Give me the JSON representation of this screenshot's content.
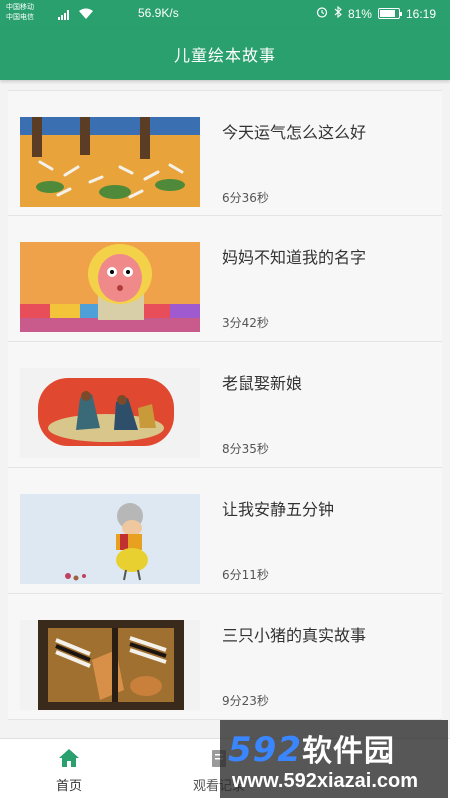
{
  "status_bar": {
    "carrier_line1": "中国移动",
    "carrier_line2": "中国电信",
    "speed": "56.9K/s",
    "battery_percent_label": "81%",
    "battery_level": 0.81,
    "time": "16:19",
    "icons": [
      "signal-icon",
      "wifi-icon",
      "alarm-icon",
      "bluetooth-icon",
      "battery-icon"
    ]
  },
  "app_bar": {
    "title": "儿童绘本故事"
  },
  "stories": [
    {
      "title": "今天运气怎么这么好",
      "duration": "6分36秒"
    },
    {
      "title": "妈妈不知道我的名字",
      "duration": "3分42秒"
    },
    {
      "title": "老鼠娶新娘",
      "duration": "8分35秒"
    },
    {
      "title": "让我安静五分钟",
      "duration": "6分11秒"
    },
    {
      "title": "三只小猪的真实故事",
      "duration": "9分23秒"
    }
  ],
  "bottom_nav": {
    "home_label": "首页",
    "history_label": "观看记录",
    "active": "home",
    "icons": [
      "home-icon",
      "history-icon"
    ]
  },
  "watermark": {
    "logo_number": "592",
    "logo_text": "软件园",
    "url": "www.592xiazai.com"
  },
  "colors": {
    "primary": "#2aa06e",
    "watermark_blue": "#3a86ff"
  }
}
